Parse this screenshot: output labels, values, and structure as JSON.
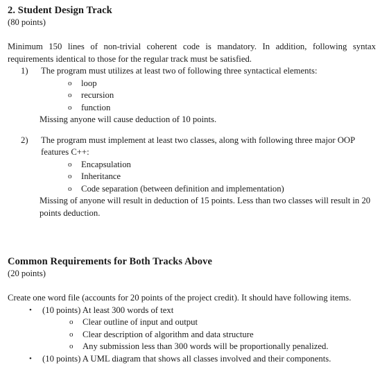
{
  "document": {
    "sections": [
      {
        "heading": "2. Student Design Track",
        "points": "(80 points)",
        "intro": "Minimum 150 lines of non-trivial coherent code is mandatory. In addition, following syntax requirements identical to those for the regular track must be satisfied.",
        "items": [
          {
            "marker": "1)",
            "text": "The program must utilizes at least two of following three syntactical elements:",
            "subitems": [
              {
                "marker": "o",
                "text": "loop"
              },
              {
                "marker": "o",
                "text": "recursion"
              },
              {
                "marker": "o",
                "text": "function"
              }
            ],
            "note": "Missing anyone will cause deduction of 10 points."
          },
          {
            "marker": "2)",
            "text": "The program must implement at least two classes, along with following three major OOP features C++:",
            "subitems": [
              {
                "marker": "o",
                "text": "Encapsulation"
              },
              {
                "marker": "o",
                "text": "Inheritance"
              },
              {
                "marker": "o",
                "text": "Code separation (between definition and implementation)"
              }
            ],
            "note": "Missing of anyone will result in deduction of 15 points. Less than two classes will result in 20 points deduction."
          }
        ]
      },
      {
        "heading": "Common Requirements for Both Tracks Above",
        "points": "(20 points)",
        "intro": "Create one word file (accounts for 20 points of the project credit). It should have following items.",
        "bullets": [
          {
            "marker": "•",
            "text": "(10 points) At least 300 words of text",
            "subitems": [
              {
                "marker": "o",
                "text": "Clear outline of input and output"
              },
              {
                "marker": "o",
                "text": "Clear description of algorithm and data structure"
              },
              {
                "marker": "o",
                "text": "Any submission less than 300 words will be proportionally penalized."
              }
            ]
          },
          {
            "marker": "•",
            "text": "(10 points) A UML diagram that shows all classes involved and their components.",
            "subitems": []
          }
        ]
      }
    ]
  }
}
